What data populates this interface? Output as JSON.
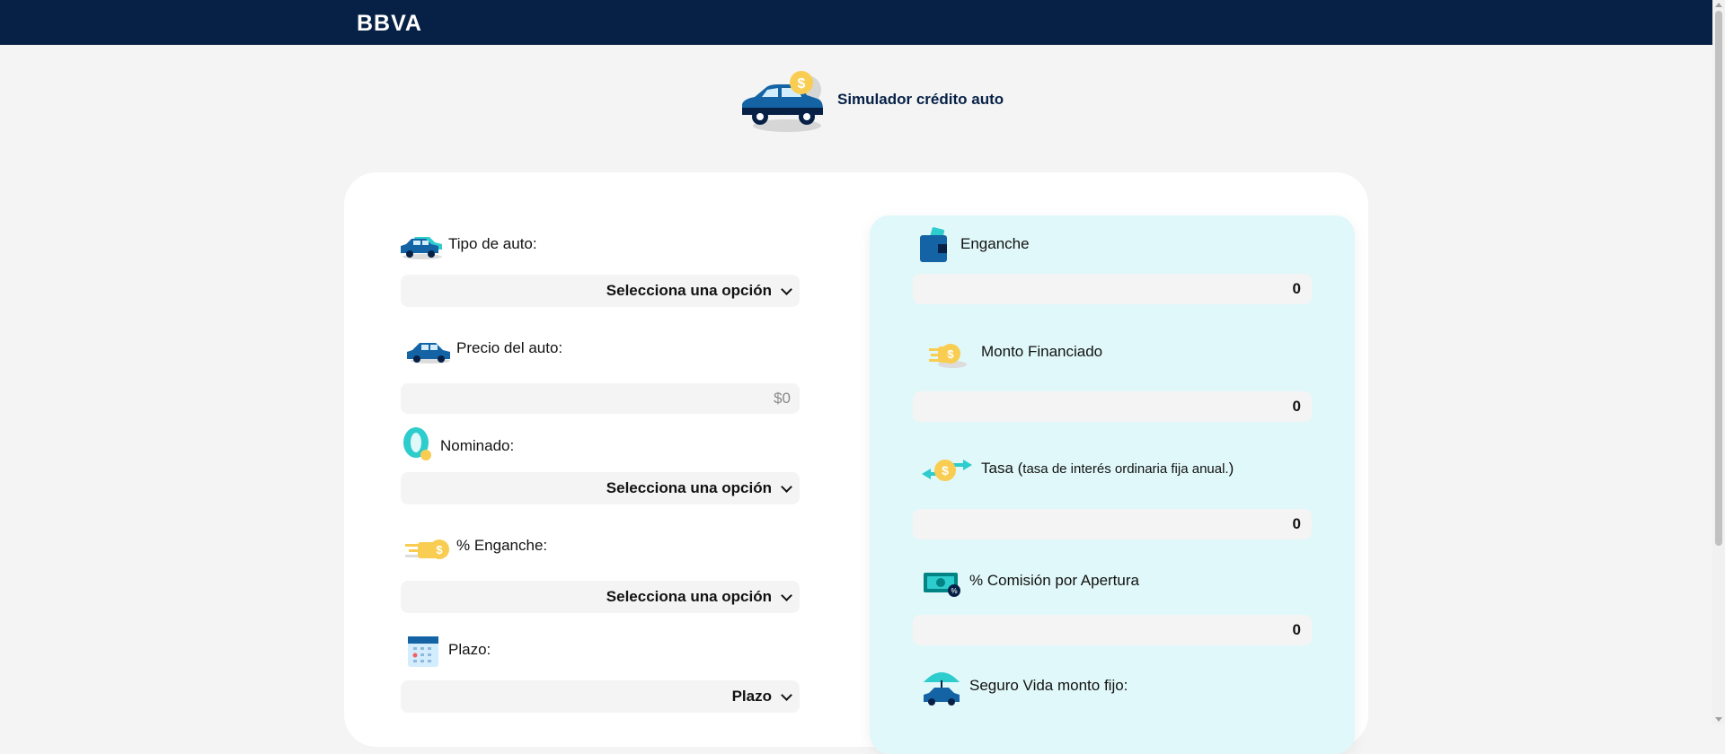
{
  "header": {
    "logo_text": "BBVA"
  },
  "page": {
    "title": "Simulador crédito auto"
  },
  "form": {
    "tipo_auto": {
      "label": "Tipo de auto:",
      "value": "Selecciona una opción"
    },
    "precio_auto": {
      "label": "Precio del auto:",
      "value": "$0"
    },
    "nominado": {
      "label": "Nominado:",
      "value": "Selecciona una opción"
    },
    "enganche_pct": {
      "label": "% Enganche:",
      "value": "Selecciona una opción"
    },
    "plazo": {
      "label": "Plazo:",
      "value": "Plazo"
    }
  },
  "results": {
    "enganche": {
      "label": "Enganche",
      "value": "0"
    },
    "monto_financiado": {
      "label": "Monto Financiado",
      "value": "0"
    },
    "tasa": {
      "label": "Tasa (",
      "label_small": "tasa de interés ordinaria fija anual.",
      "label_close": ")",
      "value": "0"
    },
    "comision": {
      "label": "% Comisión por Apertura",
      "value": "0"
    },
    "seguro_vida": {
      "label": "Seguro Vida monto fijo:"
    }
  },
  "colors": {
    "navy": "#072146",
    "panel_bg": "#e0f8f9",
    "field_bg": "#f4f4f4",
    "coin": "#f8cd51",
    "aqua": "#2dcccd"
  }
}
